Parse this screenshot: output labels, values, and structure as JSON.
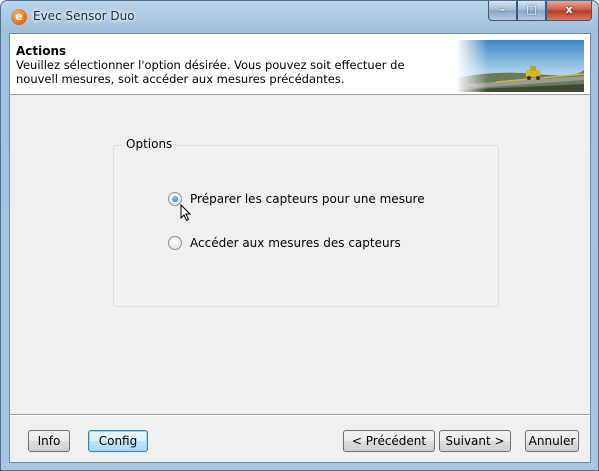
{
  "window": {
    "title": "Evec Sensor Duo",
    "icon": "evec-app-icon",
    "controls": {
      "minimize": "–",
      "maximize": "□",
      "close": "x"
    }
  },
  "header": {
    "title": "Actions",
    "description": "Veuillez sélectionner l'option désirée. Vous pouvez soit effectuer de nouvell mesures, soit accéder aux mesures précédantes."
  },
  "options": {
    "group_label": "Options",
    "items": [
      {
        "label": "Préparer les capteurs pour une mesure",
        "checked": true
      },
      {
        "label": "Accéder aux mesures des capteurs",
        "checked": false
      }
    ]
  },
  "footer": {
    "info": "Info",
    "config": "Config",
    "previous": "< Précédent",
    "next": "Suivant >",
    "cancel": "Annuler"
  }
}
